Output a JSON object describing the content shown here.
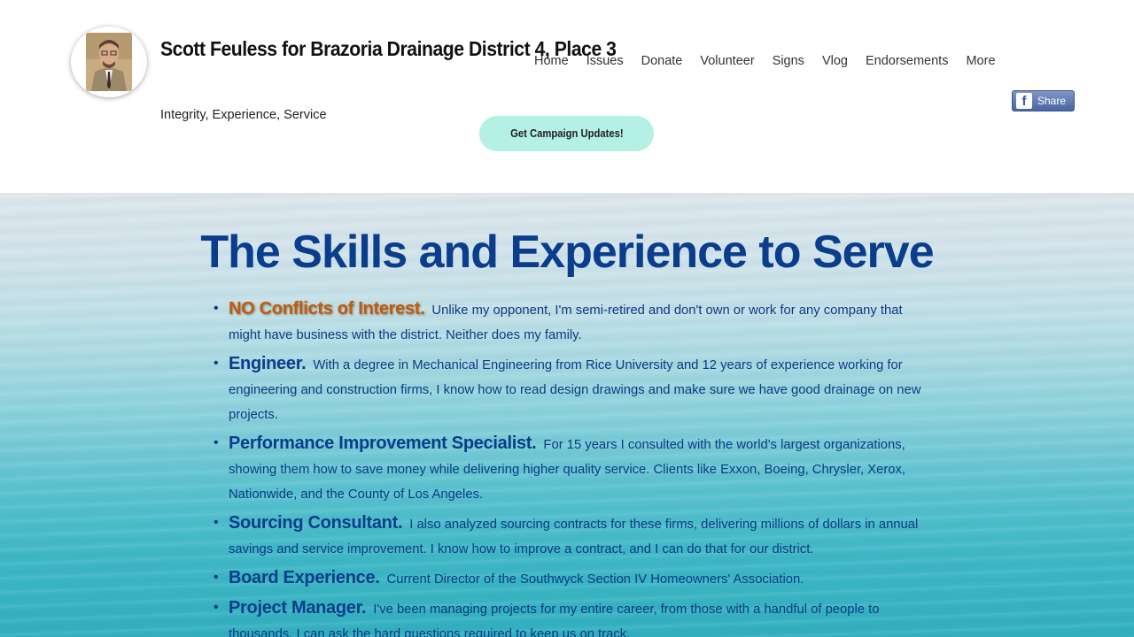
{
  "header": {
    "site_title": "Scott Feuless for Brazoria Drainage District 4, Place 3",
    "tagline": "Integrity, Experience, Service",
    "cta_label": "Get Campaign Updates!",
    "share_label": "Share",
    "facebook_glyph": "f"
  },
  "nav": {
    "items": [
      "Home",
      "Issues",
      "Donate",
      "Volunteer",
      "Signs",
      "Vlog",
      "Endorsements",
      "More"
    ]
  },
  "main": {
    "heading": "The Skills and Experience to Serve",
    "items": [
      {
        "lead": "NO Conflicts of Interest.",
        "text": "Unlike my opponent, I'm semi-retired and don't own or work for any company that might have business with the district.  Neither does my family."
      },
      {
        "lead": "Engineer.",
        "text": "With a degree in Mechanical Engineering from Rice University and 12 years of experience working for engineering and construction firms, I know how to read design drawings and make sure we have good drainage on new projects."
      },
      {
        "lead": "Performance Improvement Specialist.",
        "text": "For 15 years I consulted with the world's largest organizations, showing them how to save money while delivering higher quality service.  Clients like Exxon, Boeing, Chrysler, Xerox, Nationwide, and the County of Los Angeles."
      },
      {
        "lead": "Sourcing Consultant.",
        "text": "I also analyzed sourcing contracts for these firms, delivering millions of dollars in annual savings and service improvement.  I know how to improve a contract, and I can do that for our district."
      },
      {
        "lead": "Board Experience.",
        "text": "Current Director of the Southwyck Section IV Homeowners' Association."
      },
      {
        "lead": "Project Manager.",
        "text": "I've been managing projects for my entire career, from those with a handful of people to thousands.  I can ask the hard questions required to keep us on track."
      }
    ]
  },
  "colors": {
    "heading": "#0a3d8b",
    "highlight": "#c25a0b",
    "cta_bg": "#b4f0e4",
    "facebook": "#4a64a2"
  },
  "icons": {
    "avatar": "candidate-photo",
    "share": "facebook-icon"
  }
}
